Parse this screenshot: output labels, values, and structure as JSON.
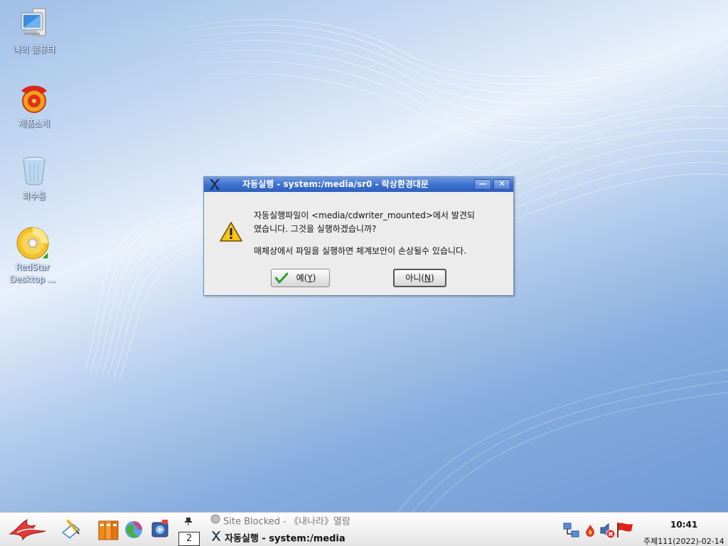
{
  "desktop": {
    "icons": [
      {
        "label": "나의 콤퓨터",
        "icon": "computer-icon"
      },
      {
        "label": "제품소개",
        "icon": "product-intro-icon"
      },
      {
        "label": "회수통",
        "icon": "trash-icon"
      },
      {
        "label_line1": "RedStar",
        "label_line2": "Desktop ...",
        "icon": "dvd-icon"
      }
    ]
  },
  "dialog": {
    "title": "자동실행 - system:/media/sr0 - 락상환경대문",
    "message_line1": "자동실행파일이 <media/cdwriter_mounted>에서 발견되",
    "message_line2": "였습니다. 그것을 실행하겠습니까?",
    "warning": "매체상에서 파일을 실행하면 체계보안이 손상될수 있습니다.",
    "yes_prefix": "예(",
    "yes_key": "Y",
    "yes_suffix": ")",
    "no_prefix": "아니(",
    "no_key": "N",
    "no_suffix": ")",
    "minimize_glyph": "—",
    "close_glyph": "✕"
  },
  "taskbar": {
    "pager_number": "2",
    "tasks": [
      {
        "label": "Site Blocked - 《내나라》열람",
        "active": false
      },
      {
        "label": "자동실행 - system:/media",
        "active": true
      }
    ],
    "clock": {
      "time": "10:41",
      "date": "주체111(2022)-02-14"
    }
  },
  "colors": {
    "titlebar": "#3f72cf",
    "taskbar": "#f1f1f1",
    "desktop": "#9fbfe6"
  }
}
